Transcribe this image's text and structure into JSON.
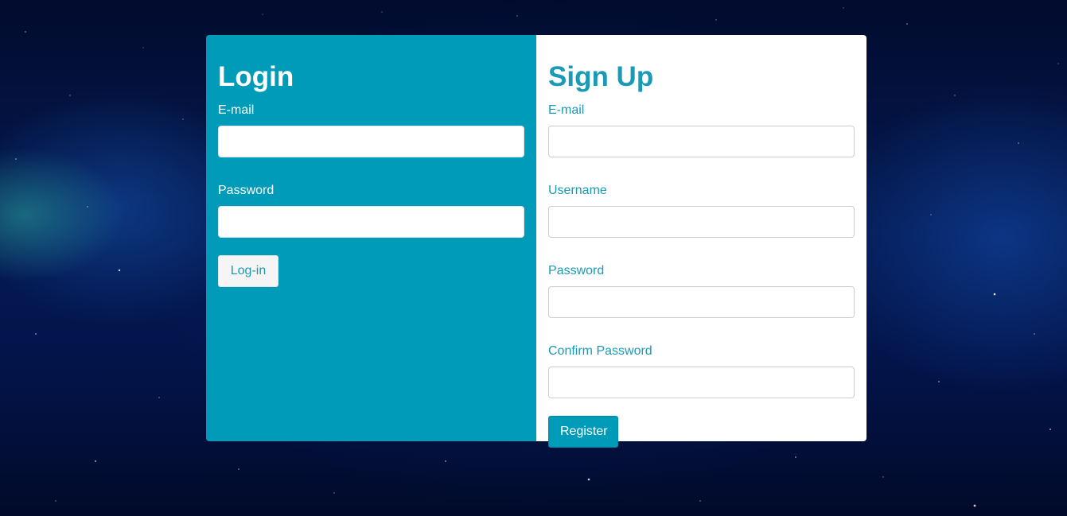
{
  "login": {
    "title": "Login",
    "email_label": "E-mail",
    "email_value": "",
    "password_label": "Password",
    "password_value": "",
    "button_label": "Log-in"
  },
  "signup": {
    "title": "Sign Up",
    "email_label": "E-mail",
    "email_value": "",
    "username_label": "Username",
    "username_value": "",
    "password_label": "Password",
    "password_value": "",
    "confirm_label": "Confirm Password",
    "confirm_value": "",
    "button_label": "Register"
  },
  "colors": {
    "accent": "#009bb9",
    "panel_white": "#ffffff",
    "background": "#041a52"
  }
}
